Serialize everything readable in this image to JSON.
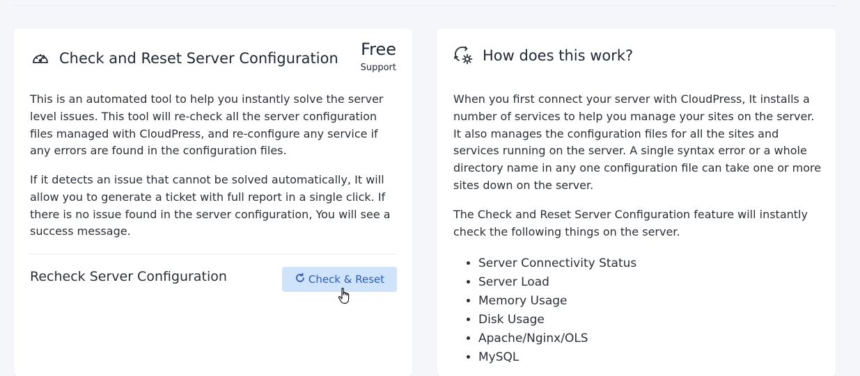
{
  "left_card": {
    "title": "Check and Reset Server Configuration",
    "plan_name": "Free",
    "plan_sub": "Support",
    "paragraph_1": "This is an automated tool to help you instantly solve the server level issues. This tool will re-check all the server configuration files managed with CloudPress, and re-configure any service if any errors are found in the configuration files.",
    "paragraph_2": "If it detects an issue that cannot be solved automatically, It will allow you to generate a ticket with full report in a single click. If there is no issue found in the server configuration, You will see a success message.",
    "recheck_label": "Recheck Server Configuration",
    "button_label": "Check & Reset",
    "icon": "speedometer-icon"
  },
  "right_card": {
    "title": "How does this work?",
    "paragraph_1": "When you first connect your server with CloudPress, It installs a number of services to help you manage your sites on the server. It also manages the configuration files for all the sites and services running on the server. A single syntax error or a whole directory name in any one configuration file can take one or more sites down on the server.",
    "paragraph_2": "The Check and Reset Server Configuration feature will instantly check the following things on the server.",
    "checks": [
      "Server Connectivity Status",
      "Server Load",
      "Memory Usage",
      "Disk Usage",
      "Apache/Nginx/OLS",
      "MySQL"
    ],
    "icon": "refresh-gear-icon"
  },
  "colors": {
    "background": "#f5f6fa",
    "card": "#ffffff",
    "button_bg": "#cfe3fb",
    "button_text": "#2b5db5",
    "text": "#1f2733"
  }
}
